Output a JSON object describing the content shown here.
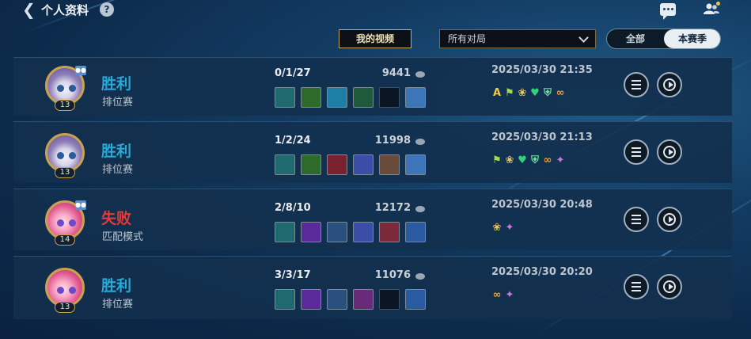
{
  "header": {
    "title": "个人资料",
    "help_glyph": "?"
  },
  "controls": {
    "my_videos": "我的视频",
    "filter_selected": "所有对局",
    "tabs": [
      "全部",
      "本赛季"
    ],
    "active_tab": "本赛季"
  },
  "colors": {
    "win": "#28a9d8",
    "lose": "#e53b3b",
    "gold_border": "#c8a95f"
  },
  "matches": [
    {
      "result": "胜利",
      "mode": "排位赛",
      "level": "13",
      "kda": "0/1/27",
      "gold": "9441",
      "date": "2025/03/30 21:35",
      "items": [
        "item-boots",
        "item-jade",
        "item-crystal",
        "item-ring",
        "empty",
        "item-potion"
      ],
      "badges": [
        "A",
        "flag-icon",
        "laurel-icon",
        "heart-icon",
        "shield-icon",
        "chain-icon"
      ]
    },
    {
      "result": "胜利",
      "mode": "排位赛",
      "level": "13",
      "kda": "1/2/24",
      "gold": "11998",
      "date": "2025/03/30 21:13",
      "items": [
        "item-boots",
        "item-jade",
        "item-mask",
        "item-dragon",
        "item-armor",
        "item-potion"
      ],
      "badges": [
        "flag-icon",
        "laurel-icon",
        "heart-icon",
        "shield-icon",
        "chain-icon",
        "wings-icon"
      ]
    },
    {
      "result": "失败",
      "mode": "匹配模式",
      "level": "14",
      "kda": "2/8/10",
      "gold": "12172",
      "date": "2025/03/30 20:48",
      "items": [
        "item-boots",
        "item-orb",
        "item-crown",
        "item-dragon",
        "item-book",
        "item-staff"
      ],
      "badges": [
        "laurel-icon",
        "wings-icon"
      ]
    },
    {
      "result": "胜利",
      "mode": "排位赛",
      "level": "13",
      "kda": "3/3/17",
      "gold": "11076",
      "date": "2025/03/30 20:20",
      "items": [
        "item-boots",
        "item-orb",
        "item-crown",
        "item-flower",
        "empty",
        "item-staff"
      ],
      "badges": [
        "chain-icon",
        "wings-icon"
      ]
    }
  ]
}
